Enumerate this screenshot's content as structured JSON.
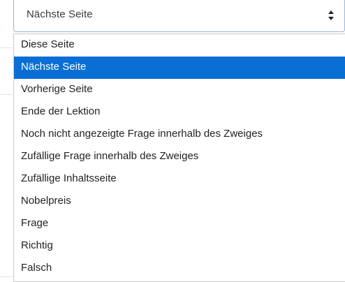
{
  "select": {
    "value": "Nächste Seite",
    "arrows_icon": "up-down-arrows-icon"
  },
  "options": [
    {
      "label": "Diese Seite",
      "selected": false
    },
    {
      "label": "Nächste Seite",
      "selected": true
    },
    {
      "label": "Vorherige Seite",
      "selected": false
    },
    {
      "label": "Ende der Lektion",
      "selected": false
    },
    {
      "label": "Noch nicht angezeigte Frage innerhalb des Zweiges",
      "selected": false
    },
    {
      "label": "Zufällige Frage innerhalb des Zweiges",
      "selected": false
    },
    {
      "label": "Zufällige Inhaltsseite",
      "selected": false
    },
    {
      "label": "Nobelpreis",
      "selected": false
    },
    {
      "label": "Frage",
      "selected": false
    },
    {
      "label": "Richtig",
      "selected": false
    },
    {
      "label": "Falsch",
      "selected": false
    }
  ],
  "colors": {
    "highlight": "#0a6fd5",
    "select_border": "#8fb6e3"
  }
}
